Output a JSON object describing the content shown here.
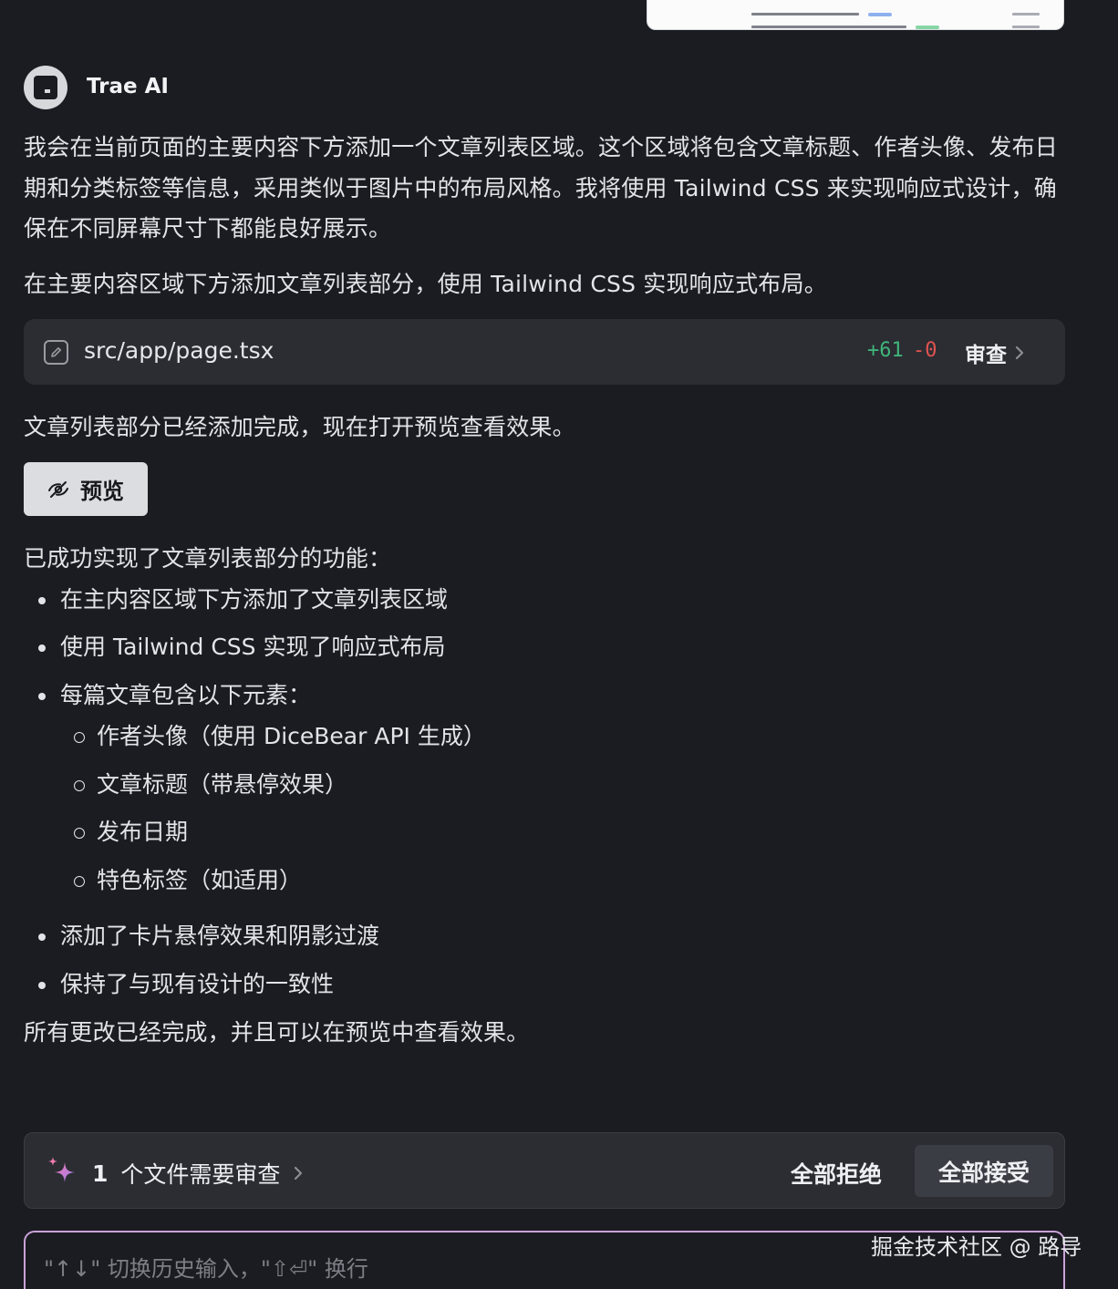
{
  "agent": {
    "name": "Trae AI"
  },
  "message": {
    "intro": "我会在当前页面的主要内容下方添加一个文章列表区域。这个区域将包含文章标题、作者头像、发布日期和分类标签等信息，采用类似于图片中的布局风格。我将使用 Tailwind CSS 来实现响应式设计，确保在不同屏幕尺寸下都能良好展示。",
    "step": "在主要内容区域下方添加文章列表部分，使用 Tailwind CSS 实现响应式布局。",
    "file_card": {
      "path": "src/app/page.tsx",
      "additions": "+61",
      "deletions": "-0",
      "review_label": "审查"
    },
    "done": "文章列表部分已经添加完成，现在打开预览查看效果。",
    "preview_label": "预览",
    "summary_title": "已成功实现了文章列表部分的功能：",
    "bullets": [
      "在主内容区域下方添加了文章列表区域",
      "使用 Tailwind CSS 实现了响应式布局",
      "每篇文章包含以下元素：",
      "添加了卡片悬停效果和阴影过渡",
      "保持了与现有设计的一致性"
    ],
    "sub_bullets": [
      "作者头像（使用 DiceBear API 生成）",
      "文章标题（带悬停效果）",
      "发布日期",
      "特色标签（如适用）"
    ],
    "closing": "所有更改已经完成，并且可以在预览中查看效果。"
  },
  "review_bar": {
    "count": "1",
    "label": "个文件需要审查",
    "reject_all": "全部拒绝",
    "accept_all": "全部接受"
  },
  "input": {
    "placeholder": "\"↑↓\" 切换历史输入，\"⇧⏎\" 换行"
  },
  "watermark": "掘金技术社区 @ 路导",
  "colors": {
    "background": "#1b1c21",
    "card": "#2b2d33",
    "diff_added": "#3fb57a",
    "diff_removed": "#e0534f",
    "input_border": "#c9a2d8"
  }
}
